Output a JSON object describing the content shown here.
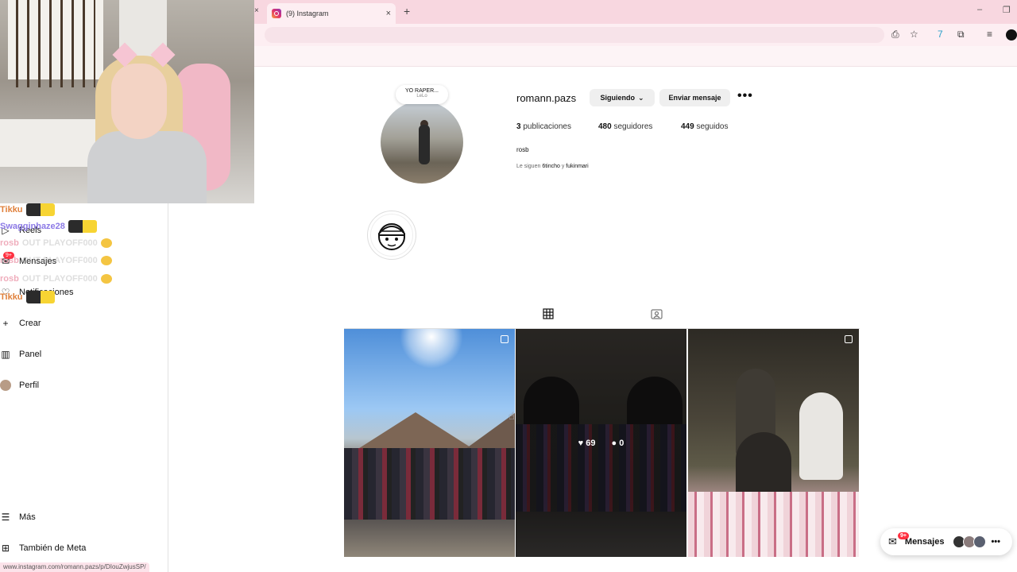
{
  "browser": {
    "tab_title": "(9) Instagram",
    "tab_close": "×",
    "new_tab": "+",
    "status_url": "www.instagram.com/romann.pazs/p/DIouZwjusSP/"
  },
  "sidebar": {
    "items": [
      {
        "label": "Reels",
        "icon": "reels-icon"
      },
      {
        "label": "Mensajes",
        "icon": "messenger-icon"
      },
      {
        "label": "Notificaciones",
        "icon": "heart-icon"
      },
      {
        "label": "Crear",
        "icon": "plus-icon"
      },
      {
        "label": "Panel",
        "icon": "dashboard-icon"
      },
      {
        "label": "Perfil",
        "icon": "avatar-icon"
      },
      {
        "label": "Más",
        "icon": "menu-icon"
      },
      {
        "label": "También de Meta",
        "icon": "meta-grid-icon"
      }
    ],
    "messages_badge": "9+"
  },
  "chat": {
    "lines": [
      {
        "user": "Tikku",
        "text": ""
      },
      {
        "user": "Swagginhaze28",
        "text": ""
      },
      {
        "user": "rosb",
        "text": "OUT PLAYOFF000"
      },
      {
        "user": "rosb",
        "text": "OUT PLAYOFF000"
      },
      {
        "user": "rosb",
        "text": "OUT PLAYOFF000"
      },
      {
        "user": "Tikku",
        "text": ""
      }
    ]
  },
  "profile": {
    "note_title": "YO RAPER...",
    "note_sub": "LeLo",
    "username": "romann.pazs",
    "following_button": "Siguiendo",
    "message_button": "Enviar mensaje",
    "more": "•••",
    "posts_count": "3",
    "posts_label": "publicaciones",
    "followers_count": "480",
    "followers_label": "seguidores",
    "following_count": "449",
    "following_label": "seguidos",
    "bio_name": "rosb",
    "followed_by_prefix": "Le siguen",
    "followed_by_1": "6tincho",
    "followed_by_joiner": "y",
    "followed_by_2": "fukinmari"
  },
  "posts": [
    {
      "name": "post-mountain-group",
      "multiple": true
    },
    {
      "name": "post-courtyard-group",
      "multiple": true,
      "likes": "69",
      "comments": "0"
    },
    {
      "name": "post-dinner-party",
      "multiple": true
    }
  ],
  "floating_messages": {
    "label": "Mensajes",
    "badge": "9+",
    "more": "•••"
  }
}
